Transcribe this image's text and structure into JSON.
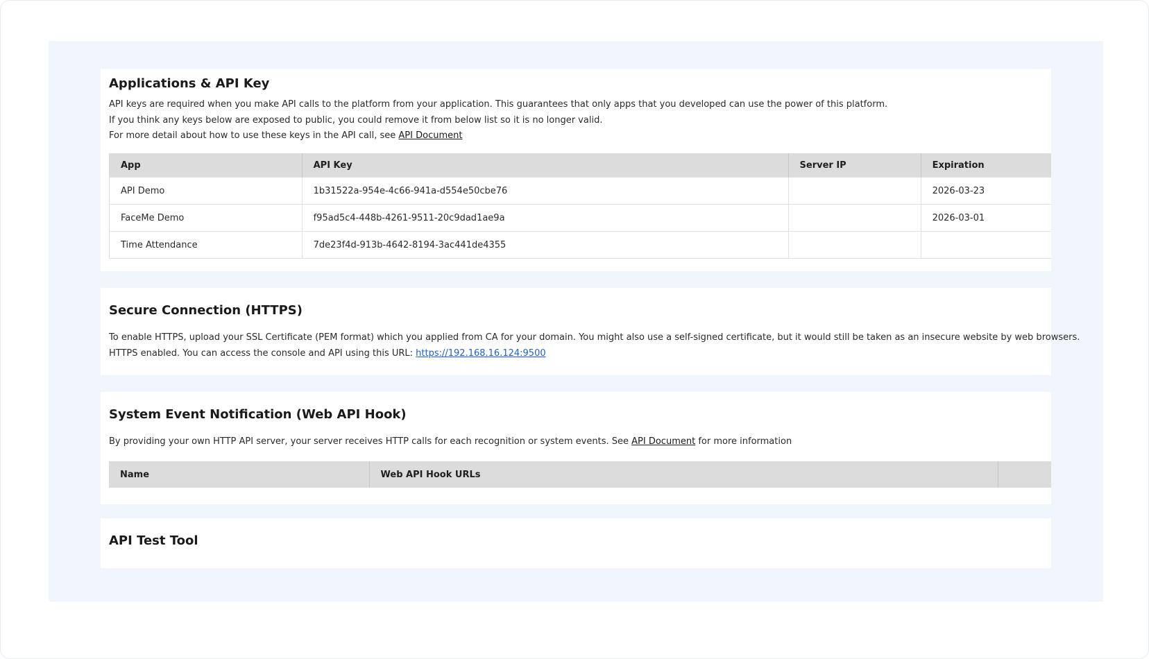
{
  "apps_section": {
    "title": "Applications & API Key",
    "desc_line1": "API keys are required when you make API calls to the platform from your application. This guarantees that only apps that you developed can use the power of this platform.",
    "desc_line2": "If you think any keys below are exposed to public, you could remove it from below list so it is no longer valid.",
    "desc_line3_prefix": "For more detail about how to use these keys in the API call, see ",
    "doc_link": "API Document",
    "columns": [
      "App",
      "API Key",
      "Server IP",
      "Expiration"
    ],
    "rows": [
      {
        "app": "API Demo",
        "key": "1b31522a-954e-4c66-941a-d554e50cbe76",
        "ip": "",
        "expiration": "2026-03-23"
      },
      {
        "app": "FaceMe Demo",
        "key": "f95ad5c4-448b-4261-9511-20c9dad1ae9a",
        "ip": "",
        "expiration": "2026-03-01"
      },
      {
        "app": "Time Attendance",
        "key": "7de23f4d-913b-4642-8194-3ac441de4355",
        "ip": "",
        "expiration": ""
      }
    ]
  },
  "https_section": {
    "title": "Secure Connection (HTTPS)",
    "desc_line1": "To enable HTTPS, upload your SSL Certificate (PEM format) which you applied from CA for your domain. You might also use a self-signed certificate, but it would still be taken as an insecure website by web browsers.",
    "desc_line2_prefix": "HTTPS enabled. You can access the console and API using this URL: ",
    "url": "https://192.168.16.124:9500"
  },
  "hook_section": {
    "title": "System Event Notification (Web API Hook)",
    "desc_prefix": "By providing your own HTTP API server, your server receives HTTP calls for each recognition or system events. See ",
    "doc_link": "API Document",
    "desc_suffix": " for more information",
    "columns": [
      "Name",
      "Web API Hook URLs",
      ""
    ]
  },
  "test_section": {
    "title": "API Test Tool"
  }
}
